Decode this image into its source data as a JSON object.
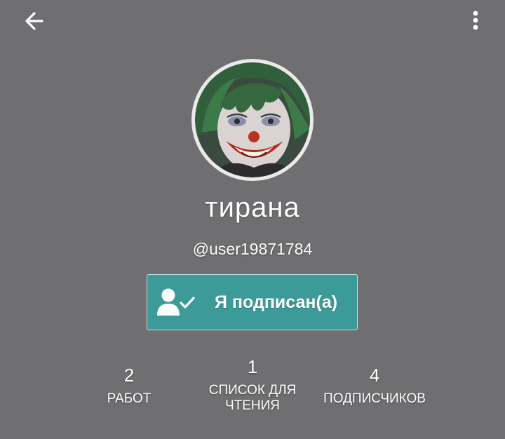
{
  "topbar": {
    "back_icon": "arrow-left-icon",
    "more_icon": "more-vertical-icon"
  },
  "profile": {
    "display_name": "тирана",
    "username": "@user19871784",
    "avatar_icon": "avatar-image"
  },
  "follow_button": {
    "label": "Я подписан(а)",
    "icon": "person-check-icon",
    "color": "#3c9a98"
  },
  "stats": [
    {
      "value": "2",
      "label": "РАБОТ"
    },
    {
      "value": "1",
      "label": "СПИСОК ДЛЯ ЧТЕНИЯ"
    },
    {
      "value": "4",
      "label": "ПОДПИСЧИКОВ"
    }
  ],
  "colors": {
    "background": "#6f6e70",
    "accent": "#3c9a98"
  }
}
